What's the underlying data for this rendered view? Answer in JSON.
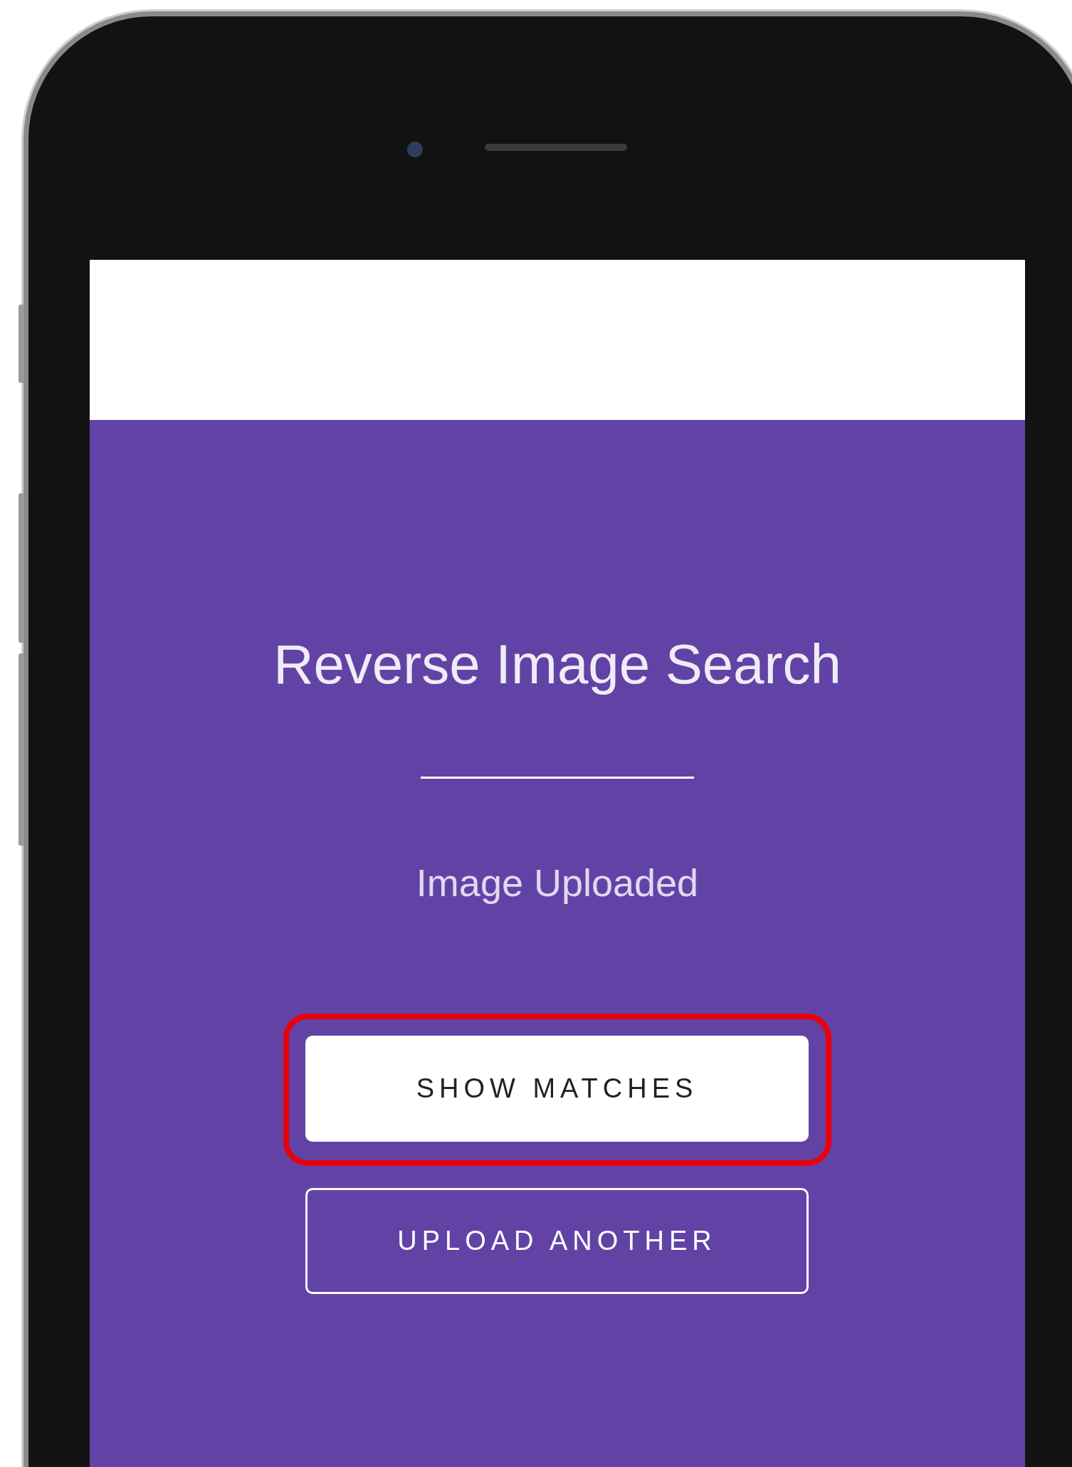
{
  "screen": {
    "title": "Reverse Image Search",
    "status": "Image Uploaded"
  },
  "buttons": [
    {
      "label": "SHOW MATCHES",
      "kind": "filled",
      "highlighted": true
    },
    {
      "label": "UPLOAD ANOTHER",
      "kind": "outline",
      "highlighted": false
    }
  ]
}
